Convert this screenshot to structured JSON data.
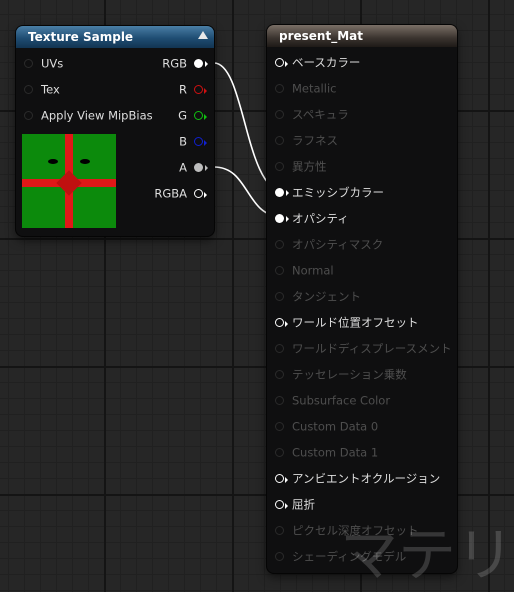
{
  "texture_node": {
    "title": "Texture Sample",
    "inputs": [
      {
        "label": "UVs"
      },
      {
        "label": "Tex"
      },
      {
        "label": "Apply View MipBias"
      }
    ],
    "outputs": [
      {
        "label": "RGB",
        "color": "#ffffff"
      },
      {
        "label": "R",
        "color": "#d01010"
      },
      {
        "label": "G",
        "color": "#10c010"
      },
      {
        "label": "B",
        "color": "#1020d0"
      },
      {
        "label": "A",
        "color": "#bdbdbd"
      },
      {
        "label": "RGBA",
        "color": "#ffffff"
      }
    ],
    "preview": {
      "background": "#0c8a0c",
      "ribbon": "#e01818"
    }
  },
  "material_node": {
    "title": "present_Mat",
    "inputs": [
      {
        "label": "ベースカラー",
        "state": "active"
      },
      {
        "label": "Metallic",
        "state": "disabled"
      },
      {
        "label": "スペキュラ",
        "state": "disabled"
      },
      {
        "label": "ラフネス",
        "state": "disabled"
      },
      {
        "label": "異方性",
        "state": "disabled"
      },
      {
        "label": "エミッシブカラー",
        "state": "connected"
      },
      {
        "label": "オパシティ",
        "state": "connected"
      },
      {
        "label": "オパシティマスク",
        "state": "disabled"
      },
      {
        "label": "Normal",
        "state": "disabled"
      },
      {
        "label": "タンジェント",
        "state": "disabled"
      },
      {
        "label": "ワールド位置オフセット",
        "state": "active"
      },
      {
        "label": "ワールドディスプレースメント",
        "state": "disabled"
      },
      {
        "label": "テッセレーション乗数",
        "state": "disabled"
      },
      {
        "label": "Subsurface Color",
        "state": "disabled"
      },
      {
        "label": "Custom Data 0",
        "state": "disabled"
      },
      {
        "label": "Custom Data 1",
        "state": "disabled"
      },
      {
        "label": "アンビエントオクルージョン",
        "state": "active"
      },
      {
        "label": "屈折",
        "state": "active"
      },
      {
        "label": "ピクセル深度オフセット",
        "state": "disabled"
      },
      {
        "label": "シェーディングモデル",
        "state": "disabled"
      }
    ]
  },
  "connections": [
    {
      "from": "RGB",
      "to": "エミッシブカラー"
    },
    {
      "from": "A",
      "to": "オパシティ"
    }
  ],
  "watermark": "マテリア",
  "colors": {
    "texture_header": "#1f4d73",
    "material_header": "#3a332e",
    "wire": "#ffffff"
  }
}
